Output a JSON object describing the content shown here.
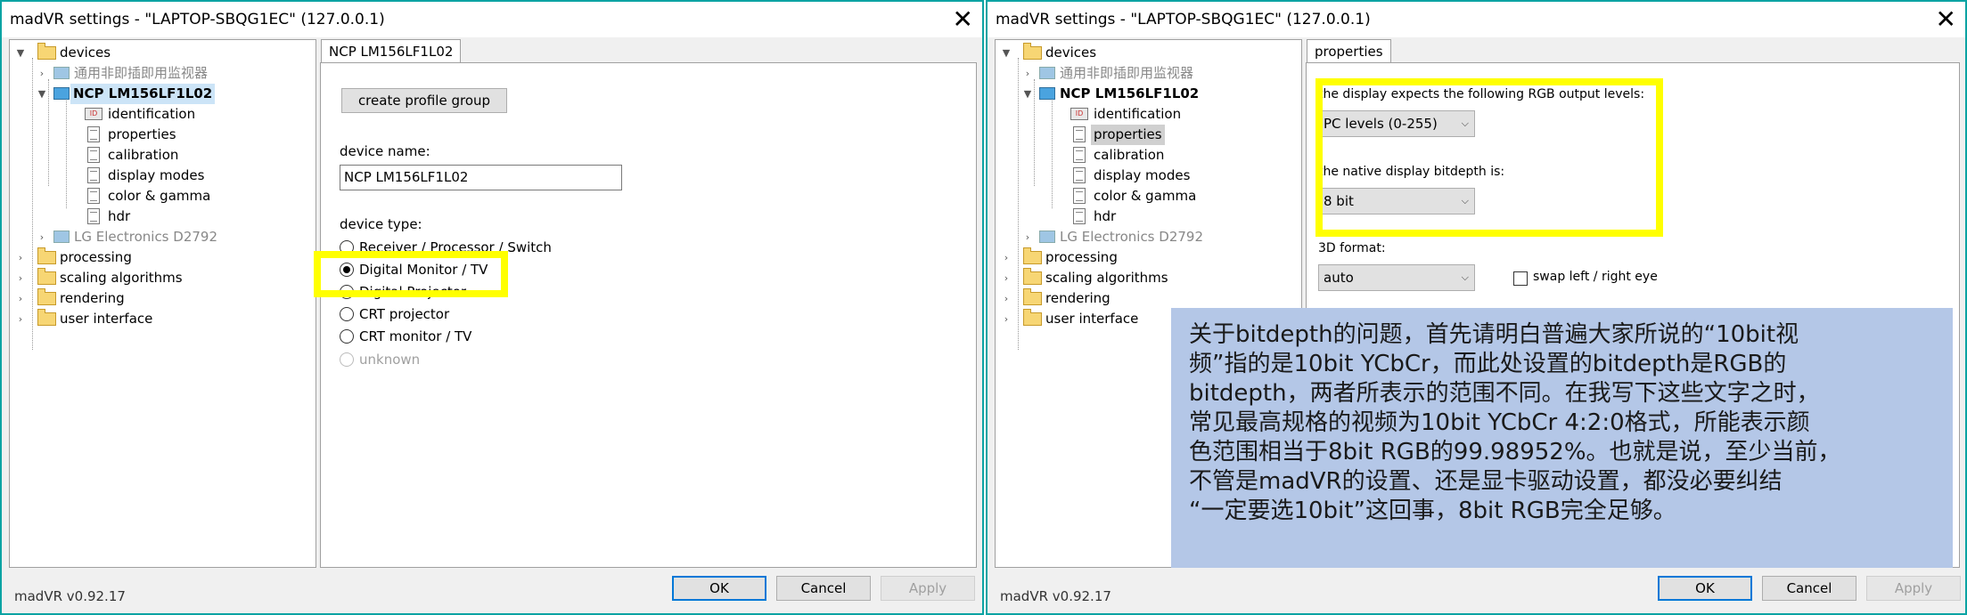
{
  "left_window": {
    "title": "madVR settings - \"LAPTOP-SBQG1EC\" (127.0.0.1)",
    "tree": {
      "devices": "devices",
      "generic_monitor": "通用非即插即用监视器",
      "ncp": "NCP LM156LF1L02",
      "identification": "identification",
      "properties": "properties",
      "calibration": "calibration",
      "display_modes": "display modes",
      "color_gamma": "color & gamma",
      "hdr": "hdr",
      "lg": "LG Electronics D2792",
      "processing": "processing",
      "scaling": "scaling algorithms",
      "rendering": "rendering",
      "user_interface": "user interface"
    },
    "tab_label": "NCP LM156LF1L02",
    "create_profile_group": "create profile group",
    "device_name_label": "device name:",
    "device_name_value": "NCP LM156LF1L02",
    "device_type_label": "device type:",
    "device_types": {
      "receiver": "Receiver / Processor / Switch",
      "digital_monitor": "Digital Monitor / TV",
      "digital_projector": "Digital Projector",
      "crt_projector": "CRT projector",
      "crt_monitor": "CRT monitor / TV",
      "unknown": "unknown"
    },
    "version": "madVR v0.92.17",
    "ok": "OK",
    "cancel": "Cancel",
    "apply": "Apply"
  },
  "right_window": {
    "title": "madVR settings - \"LAPTOP-SBQG1EC\" (127.0.0.1)",
    "tree": {
      "devices": "devices",
      "generic_monitor": "通用非即插即用监视器",
      "ncp": "NCP LM156LF1L02",
      "identification": "identification",
      "properties": "properties",
      "calibration": "calibration",
      "display_modes": "display modes",
      "color_gamma": "color & gamma",
      "hdr": "hdr",
      "lg": "LG Electronics D2792",
      "processing": "processing",
      "scaling": "scaling algorithms",
      "rendering": "rendering",
      "user_interface": "user interface"
    },
    "tab_label": "properties",
    "rgb_levels_label": "the display expects the following RGB output levels:",
    "rgb_levels_value": "PC levels (0-255)",
    "bitdepth_label": "the native display bitdepth is:",
    "bitdepth_value": "8 bit",
    "format_3d_label": "3D format:",
    "format_3d_value": "auto",
    "swap_label": "swap left / right eye",
    "version": "madVR v0.92.17",
    "ok": "OK",
    "cancel": "Cancel",
    "apply": "Apply"
  },
  "annotation": {
    "lines": [
      "关于bitdepth的问题，首先请明白普遍大家所说的“10bit视",
      "频”指的是10bit YCbCr，而此处设置的bitdepth是RGB的",
      "bitdepth，两者所表示的范围不同。在我写下这些文字之时，",
      "常见最高规格的视频为10bit YCbCr 4:2:0格式，所能表示颜",
      "色范围相当于8bit RGB的99.98952%。也就是说，至少当前，",
      "不管是madVR的设置、还是显卡驱动设置，都没必要纠结",
      "“一定要选10bit”这回事，8bit RGB完全足够。"
    ]
  },
  "colors": {
    "highlight": "#ffff00",
    "annotation_bg": "#b4c7e7",
    "window_border": "#0aa3a3",
    "accent": "#0078d7"
  },
  "icons": {
    "tree_node": "folder-icon",
    "device": "monitor-icon",
    "settings_page": "page-icon",
    "identification": "id-card-icon",
    "close": "close-icon"
  }
}
